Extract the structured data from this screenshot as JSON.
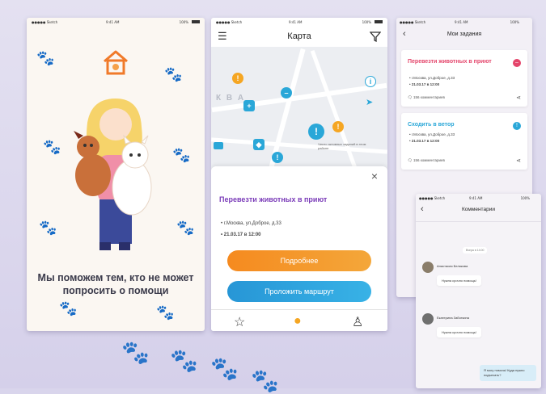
{
  "phone1": {
    "status": {
      "carrier": "●●●●● Sketch",
      "time": "9:41 AM",
      "battery": "100%"
    },
    "tagline": "Мы поможем тем, кто не может попросить о помощи"
  },
  "phone2": {
    "status": {
      "carrier": "●●●●● Sketch",
      "time": "9:41 AM",
      "battery": "100%"
    },
    "title": "Карта",
    "map_label": "К В А",
    "map_tooltip": "Число активных заданий в этом районе",
    "card": {
      "title": "Перевезти животных в приют",
      "address": "г.Москва, ул.Доброе, д.33",
      "datetime": "21.03.17 в 12:00"
    },
    "details_button": "Подробнее",
    "route_button": "Проложить маршрут"
  },
  "phone3": {
    "status": {
      "carrier": "●●●●● Sketch",
      "time": "9:41 AM",
      "battery": "100%"
    },
    "title": "Мои задания",
    "tasks": [
      {
        "title": "Перевезти животных в приют",
        "address": "г.Москва, ул.Доброе, д.33",
        "datetime": "21.03.17 в 12:00",
        "comments": "156 комментариев",
        "color": "#e4456b"
      },
      {
        "title": "Сходить в ветор",
        "address": "г.Москва, ул.Доброе, д.33",
        "datetime": "21.03.17 в 12:00",
        "comments": "156 комментариев",
        "color": "#2aa7d8"
      }
    ]
  },
  "phone4": {
    "status": {
      "carrier": "●●●●● Sketch",
      "time": "9:41 AM",
      "battery": "100%"
    },
    "title": "Комментарии",
    "date": "Вчера в 14:00",
    "messages": [
      {
        "name": "Анастасия Белякова",
        "text": "Нужна срочно помощь!"
      },
      {
        "name": "Екатерина Заботкина",
        "text": "Нужна срочно помощь!"
      }
    ],
    "my_message": "Я могу помочь! Куда нужно подъехать?"
  }
}
